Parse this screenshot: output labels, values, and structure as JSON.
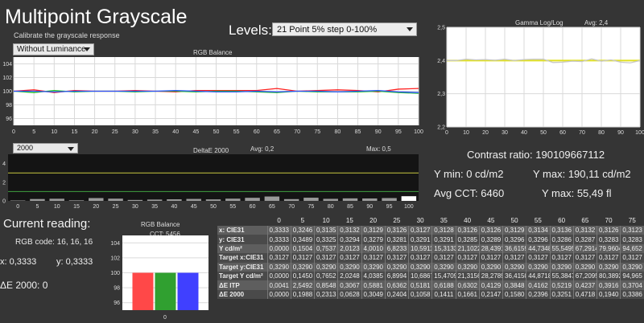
{
  "header": {
    "title": "Multipoint Grayscale",
    "subtitle": "Calibrate the grayscale response",
    "luminance_select": "Without Luminance",
    "levels_label": "Levels:",
    "levels_select": "21 Point 5% step 0-100%"
  },
  "rgb_chart": {
    "title": "RGB Balance",
    "y_ticks": [
      "104",
      "102",
      "100",
      "98",
      "96"
    ],
    "x_ticks": [
      "0",
      "5",
      "10",
      "15",
      "20",
      "25",
      "30",
      "35",
      "40",
      "45",
      "50",
      "55",
      "60",
      "65",
      "70",
      "75",
      "80",
      "85",
      "90",
      "95",
      "100"
    ]
  },
  "gamma_chart": {
    "title": "Gamma Log/Log",
    "avg": "Avg: 2,4",
    "y_ticks": [
      "2,5",
      "2,4",
      "2,3",
      "2,2"
    ],
    "x_ticks": [
      "0",
      "10",
      "20",
      "30",
      "40",
      "50",
      "60",
      "70",
      "80",
      "90",
      "100"
    ]
  },
  "delta_chart": {
    "select": "2000",
    "title": "DeltaE 2000",
    "avg": "Avg: 0,2",
    "max": "Max: 0,5",
    "y_ticks": [
      "4",
      "2",
      "0"
    ],
    "x_ticks": [
      "0",
      "5",
      "10",
      "15",
      "20",
      "25",
      "30",
      "35",
      "40",
      "45",
      "50",
      "55",
      "60",
      "65",
      "70",
      "75",
      "80",
      "85",
      "90",
      "95",
      "100"
    ]
  },
  "stats": {
    "contrast": "Contrast ratio: 190109667112",
    "y_min": "Y min: 0 cd/m2",
    "y_max": "Y max: 190,11 cd/m2",
    "avg_cct": "Avg CCT: 6460",
    "y_max_fl": "Y max: 55,49 fl"
  },
  "current": {
    "heading": "Current reading:",
    "rgb_code": "RGB code: 16, 16, 16",
    "x": "x: 0,3333",
    "y": "y: 0,3333",
    "de": "ΔE 2000: 0"
  },
  "mini_chart": {
    "title": "RGB Balance",
    "cct": "CCT: 5456",
    "y_ticks": [
      "104",
      "102",
      "100",
      "98",
      "96"
    ],
    "x_tick": "0"
  },
  "chart_data": [
    {
      "type": "line",
      "title": "RGB Balance",
      "x": [
        0,
        5,
        10,
        15,
        20,
        25,
        30,
        35,
        40,
        45,
        50,
        55,
        60,
        65,
        70,
        75,
        80,
        85,
        90,
        95,
        100
      ],
      "ylim": [
        95,
        105
      ],
      "series": [
        {
          "color": "#ff2020",
          "values": [
            100.0,
            100.2,
            99.8,
            100.1,
            100.0,
            100.0,
            100.1,
            100.0,
            99.9,
            100.1,
            100.1,
            100.1,
            100.1,
            100.4,
            100.0,
            100.1,
            100.2,
            100.1,
            99.9,
            100.3,
            100.4
          ]
        },
        {
          "color": "#20c020",
          "values": [
            100.0,
            99.8,
            100.1,
            99.9,
            100.0,
            100.0,
            99.9,
            100.0,
            100.0,
            99.9,
            100.0,
            100.0,
            99.9,
            99.8,
            100.0,
            99.9,
            99.9,
            99.9,
            100.0,
            99.8,
            99.7
          ]
        },
        {
          "color": "#3050ff",
          "values": [
            100.0,
            100.0,
            99.9,
            100.0,
            100.0,
            100.0,
            100.0,
            100.0,
            100.1,
            100.0,
            99.9,
            99.9,
            100.0,
            99.9,
            100.0,
            100.0,
            99.9,
            100.0,
            100.1,
            99.9,
            99.8
          ]
        }
      ]
    },
    {
      "type": "line",
      "title": "Gamma Log/Log",
      "x": [
        0,
        5,
        10,
        15,
        20,
        25,
        30,
        35,
        40,
        45,
        50,
        55,
        60,
        65,
        70,
        75,
        80,
        85,
        90,
        95,
        100
      ],
      "ylim": [
        2.2,
        2.5
      ],
      "series": [
        {
          "color": "#e0e020",
          "values": [
            2.4,
            2.4,
            2.4,
            2.4,
            2.4,
            2.4,
            2.4,
            2.4,
            2.4,
            2.4,
            2.4,
            2.4,
            2.4,
            2.4,
            2.4,
            2.4,
            2.4,
            2.4,
            2.4,
            2.4,
            2.4
          ]
        },
        {
          "color": "#c8c8c8",
          "values": [
            2.4,
            2.4,
            2.404,
            2.402,
            2.403,
            2.401,
            2.404,
            2.4,
            2.403,
            2.404,
            2.404,
            2.394,
            2.395,
            2.398,
            2.397,
            2.405,
            2.398,
            2.402,
            2.395,
            2.393,
            2.4
          ]
        }
      ]
    },
    {
      "type": "bar",
      "title": "DeltaE 2000",
      "categories": [
        "0",
        "5",
        "10",
        "15",
        "20",
        "25",
        "30",
        "35",
        "40",
        "45",
        "50",
        "55",
        "60",
        "65",
        "70",
        "75",
        "80",
        "85",
        "90",
        "95",
        "100"
      ],
      "values": [
        0.0,
        0.2,
        0.23,
        0.06,
        0.3,
        0.24,
        0.1,
        0.14,
        0.17,
        0.21,
        0.16,
        0.24,
        0.33,
        0.47,
        0.19,
        0.34,
        0.22,
        0.27,
        0.26,
        0.3,
        0.5
      ],
      "ylim": [
        0,
        5
      ],
      "reference_lines": [
        {
          "y": 3,
          "color": "#c8c840"
        },
        {
          "y": 1,
          "color": "#40a040"
        }
      ]
    },
    {
      "type": "bar",
      "title": "RGB Balance",
      "categories": [
        "R",
        "G",
        "B"
      ],
      "values": [
        100,
        100,
        100
      ],
      "colors": [
        "#ff4848",
        "#30a030",
        "#4040ff"
      ],
      "ylim": [
        95,
        105
      ]
    }
  ],
  "table": {
    "columns": [
      "0",
      "5",
      "10",
      "15",
      "20",
      "25",
      "30",
      "35",
      "40",
      "45",
      "50",
      "55",
      "60",
      "65",
      "70",
      "75"
    ],
    "rows": [
      {
        "label": "x: CIE31",
        "values": [
          "0,3333",
          "0,3246",
          "0,3135",
          "0,3132",
          "0,3129",
          "0,3126",
          "0,3127",
          "0,3128",
          "0,3126",
          "0,3126",
          "0,3129",
          "0,3134",
          "0,3136",
          "0,3132",
          "0,3126",
          "0,3123"
        ]
      },
      {
        "label": "y: CIE31",
        "values": [
          "0,3333",
          "0,3489",
          "0,3325",
          "0,3294",
          "0,3279",
          "0,3281",
          "0,3291",
          "0,3291",
          "0,3285",
          "0,3289",
          "0,3296",
          "0,3296",
          "0,3286",
          "0,3287",
          "0,3283",
          "0,3283"
        ]
      },
      {
        "label": "Y cd/m²",
        "values": [
          "0,0000",
          "0,1504",
          "0,7537",
          "2,0123",
          "4,0010",
          "6,8233",
          "10,5911",
          "15,3133",
          "21,1022",
          "28,4391",
          "36,6159",
          "44,7348",
          "55,5495",
          "67,2914",
          "79,9604",
          "94,652"
        ]
      },
      {
        "label": "Target x:CIE31",
        "values": [
          "0,3127",
          "0,3127",
          "0,3127",
          "0,3127",
          "0,3127",
          "0,3127",
          "0,3127",
          "0,3127",
          "0,3127",
          "0,3127",
          "0,3127",
          "0,3127",
          "0,3127",
          "0,3127",
          "0,3127",
          "0,3127"
        ]
      },
      {
        "label": "Target y:CIE31",
        "values": [
          "0,3290",
          "0,3290",
          "0,3290",
          "0,3290",
          "0,3290",
          "0,3290",
          "0,3290",
          "0,3290",
          "0,3290",
          "0,3290",
          "0,3290",
          "0,3290",
          "0,3290",
          "0,3290",
          "0,3290",
          "0,3290"
        ]
      },
      {
        "label": "Target Y cd/m²",
        "values": [
          "0,0000",
          "0,1450",
          "0,7652",
          "2,0248",
          "4,0385",
          "6,8994",
          "10,6867",
          "15,4709",
          "21,3156",
          "28,2789",
          "36,4150",
          "44,8718",
          "55,3847",
          "67,2095",
          "80,3892",
          "94,965"
        ]
      },
      {
        "label": "ΔE ITP",
        "values": [
          "0,0041",
          "2,5492",
          "0,8548",
          "0,3067",
          "0,5881",
          "0,6362",
          "0,5181",
          "0,6188",
          "0,6302",
          "0,4129",
          "0,3848",
          "0,4162",
          "0,5219",
          "0,4237",
          "0,3916",
          "0,3704"
        ]
      },
      {
        "label": "ΔE 2000",
        "values": [
          "0,0000",
          "0,1988",
          "0,2313",
          "0,0628",
          "0,3049",
          "0,2404",
          "0,1058",
          "0,1411",
          "0,1661",
          "0,2147",
          "0,1580",
          "0,2396",
          "0,3251",
          "0,4718",
          "0,1940",
          "0,3386"
        ]
      }
    ]
  }
}
